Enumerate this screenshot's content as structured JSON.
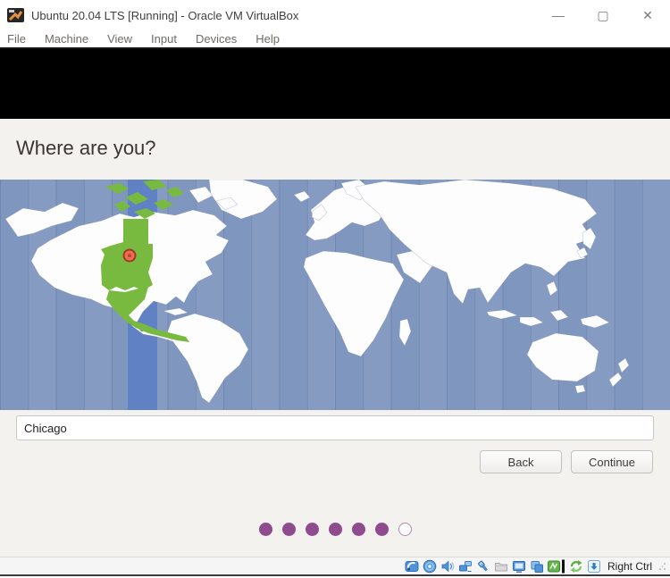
{
  "window": {
    "title": "Ubuntu 20.04 LTS [Running] - Oracle VM VirtualBox",
    "minimize_label": "—",
    "maximize_label": "▢",
    "close_label": "✕"
  },
  "menu": {
    "items": [
      "File",
      "Machine",
      "View",
      "Input",
      "Devices",
      "Help"
    ]
  },
  "installer": {
    "heading": "Where are you?",
    "location_input": {
      "value": "Chicago"
    },
    "buttons": {
      "back": "Back",
      "continue": "Continue"
    },
    "progress": {
      "completed": 6,
      "total": 7
    },
    "map": {
      "colors": {
        "ocean": "#7f96bf",
        "selected_band": "#6081c3",
        "land": "#fdfdfe",
        "selected_zone": "#78ba40",
        "marker": "#ed6f4f",
        "marker_ring": "#a03a26"
      }
    }
  },
  "status_bar": {
    "host_key": "Right Ctrl",
    "icons": [
      "hard-disks",
      "optical-drives",
      "audio",
      "network",
      "usb",
      "shared-folders",
      "display",
      "recording",
      "features-indicator",
      "mouse-integration",
      "keyboard"
    ]
  }
}
